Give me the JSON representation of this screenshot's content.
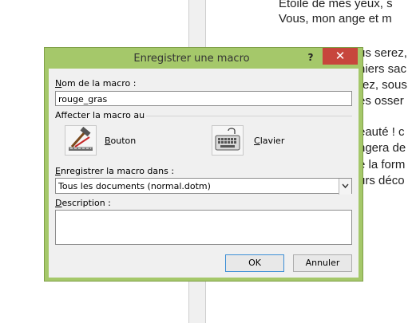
{
  "background_document": {
    "lines": [
      "Étoile de mes yeux, s",
      "Vous, mon ange et m",
      "us serez,",
      "niers sac",
      "rez, sous",
      "es osser",
      "eauté ! c",
      "ngera de",
      "è la form",
      "urs déco"
    ]
  },
  "dialog": {
    "title": "Enregistrer une macro",
    "help_label": "?",
    "close_label": "✕",
    "macro_name": {
      "label_accel": "N",
      "label_rest": "om de la macro :",
      "value": "rouge_gras"
    },
    "assign": {
      "label": "Affecter la macro au",
      "button_option": {
        "accel": "B",
        "rest": "outon"
      },
      "keyboard_option": {
        "accel": "C",
        "rest": "lavier"
      }
    },
    "store_in": {
      "label_accel": "E",
      "label_rest": "nregistrer la macro dans :",
      "value": "Tous les documents (normal.dotm)"
    },
    "description": {
      "label_accel": "D",
      "label_rest": "escription :",
      "value": ""
    },
    "ok_label": "OK",
    "cancel_label": "Annuler"
  },
  "colors": {
    "frame": "#a5c86a",
    "close_button": "#c7463c",
    "client": "#f0f0f0",
    "default_button_border": "#3d8fd6"
  }
}
